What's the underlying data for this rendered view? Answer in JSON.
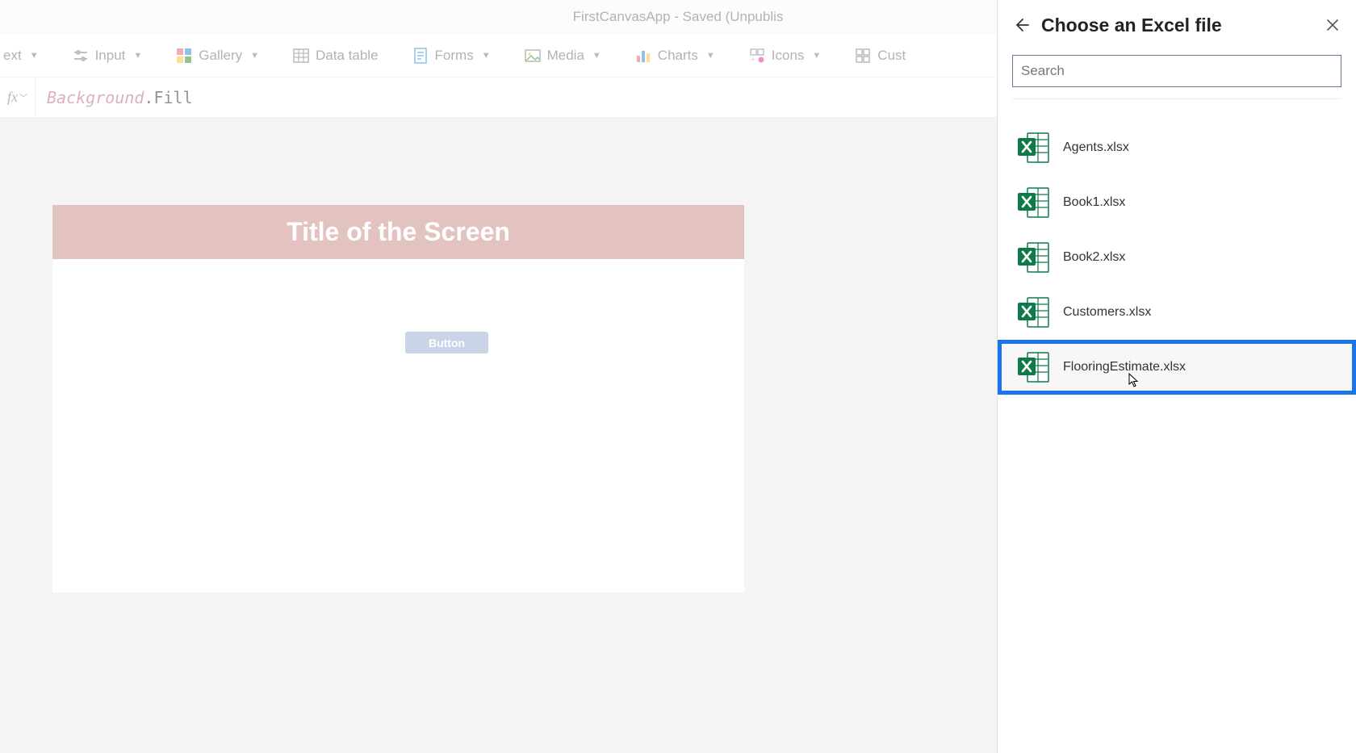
{
  "titlebar": {
    "text": "FirstCanvasApp - Saved (Unpublis"
  },
  "ribbon": {
    "items": [
      {
        "label": "ext",
        "hasChevron": true
      },
      {
        "label": "Input",
        "hasChevron": true
      },
      {
        "label": "Gallery",
        "hasChevron": true
      },
      {
        "label": "Data table",
        "hasChevron": false
      },
      {
        "label": "Forms",
        "hasChevron": true
      },
      {
        "label": "Media",
        "hasChevron": true
      },
      {
        "label": "Charts",
        "hasChevron": true
      },
      {
        "label": "Icons",
        "hasChevron": true
      },
      {
        "label": "Cust",
        "hasChevron": false
      }
    ]
  },
  "formula_bar": {
    "fx": "fx",
    "bg_part": "Background",
    "fill_part": ".Fill"
  },
  "canvas": {
    "screen_title": "Title of the Screen",
    "button_label": "Button"
  },
  "panel": {
    "title": "Choose an Excel file",
    "search_placeholder": "Search",
    "files": [
      {
        "name": "Agents.xlsx"
      },
      {
        "name": "Book1.xlsx"
      },
      {
        "name": "Book2.xlsx"
      },
      {
        "name": "Customers.xlsx"
      },
      {
        "name": "FlooringEstimate.xlsx"
      }
    ],
    "highlighted_index": 4
  }
}
